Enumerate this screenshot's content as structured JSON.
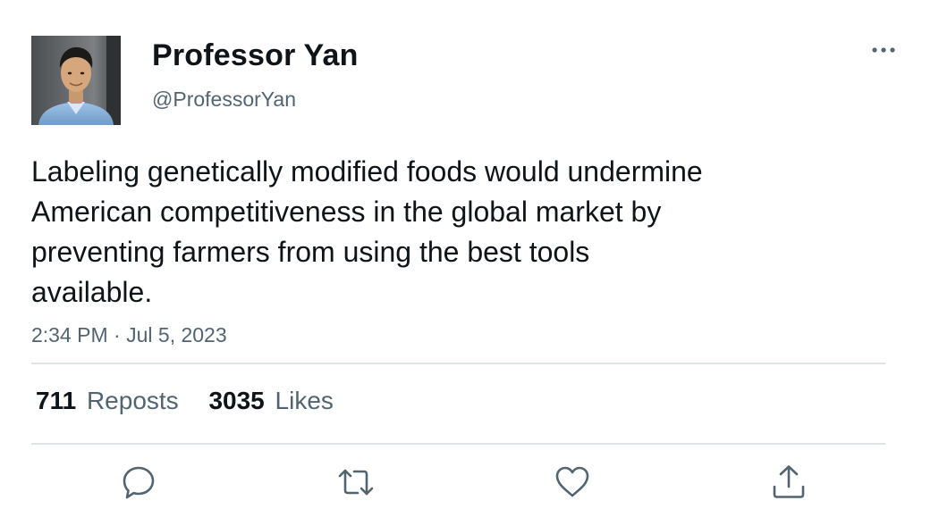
{
  "author": {
    "display_name": "Professor Yan",
    "handle": "@ProfessorYan",
    "avatar_icon": "profile-photo"
  },
  "tweet": {
    "text_lines": [
      "Labeling genetically modified foods would undermine",
      "American competitiveness in the global market by",
      "preventing farmers from using the best tools",
      "available."
    ],
    "time": "2:34 PM",
    "separator": "·",
    "date": "Jul 5, 2023"
  },
  "stats": {
    "reposts_count": "711",
    "reposts_label": "Reposts",
    "likes_count": "3035",
    "likes_label": "Likes"
  },
  "actions": [
    {
      "icon": "reply-icon"
    },
    {
      "icon": "repost-icon"
    },
    {
      "icon": "like-icon"
    },
    {
      "icon": "share-icon"
    }
  ],
  "colors": {
    "text_primary": "#0f1419",
    "text_secondary": "#536471",
    "divider": "#e1e4e7",
    "icon": "#536471"
  }
}
